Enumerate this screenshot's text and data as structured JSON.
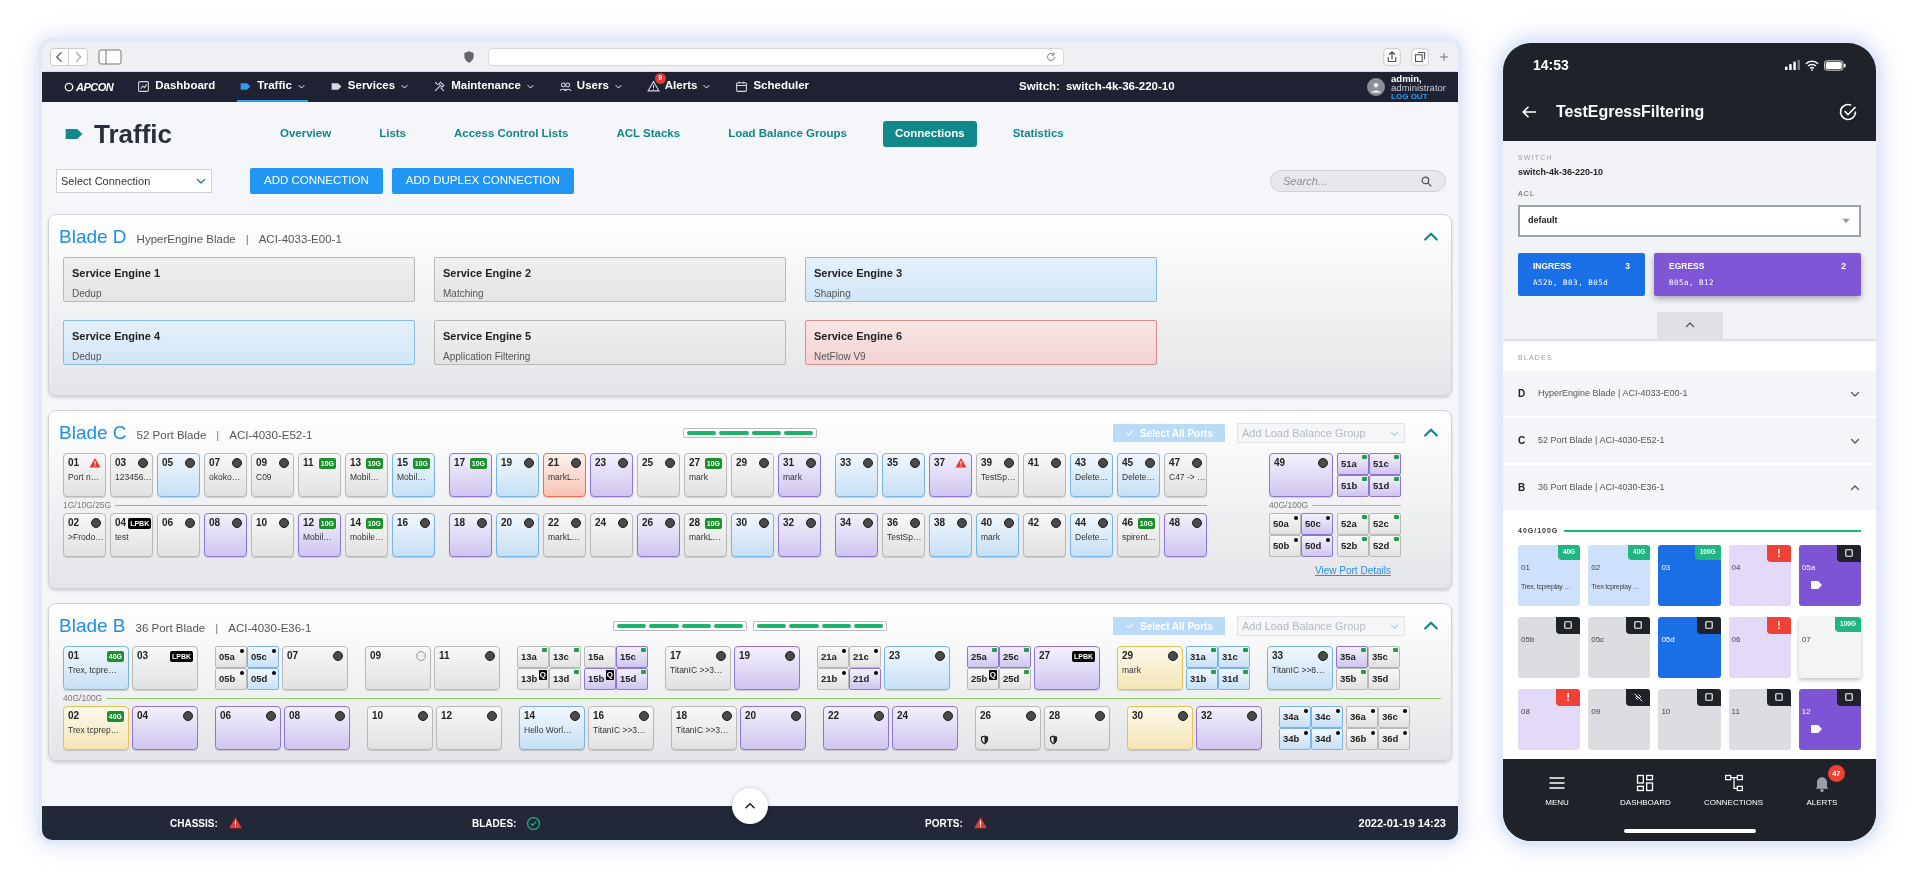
{
  "nav": {
    "logo": "APCON",
    "items": [
      {
        "kind": "dashboard",
        "label": "Dashboard",
        "menu": false,
        "selected": false
      },
      {
        "kind": "traffic",
        "label": "Traffic",
        "menu": true,
        "selected": true
      },
      {
        "kind": "services",
        "label": "Services",
        "menu": true,
        "selected": false
      },
      {
        "kind": "maintenance",
        "label": "Maintenance",
        "menu": true,
        "selected": false
      },
      {
        "kind": "users",
        "label": "Users",
        "menu": true,
        "selected": false
      },
      {
        "kind": "alerts",
        "label": "Alerts",
        "menu": true,
        "selected": false,
        "badge": "9"
      },
      {
        "kind": "scheduler",
        "label": "Scheduler",
        "menu": false,
        "selected": false
      }
    ],
    "switch_label": "Switch:",
    "switch_value": "switch-4k-36-220-10",
    "user_name": "admin,",
    "user_role": "administrator",
    "logout": "LOG OUT"
  },
  "page": {
    "title": "Traffic",
    "tabs": [
      {
        "label": "Overview",
        "selected": false
      },
      {
        "label": "Lists",
        "selected": false
      },
      {
        "label": "Access Control Lists",
        "selected": false
      },
      {
        "label": "ACL Stacks",
        "selected": false
      },
      {
        "label": "Load Balance Groups",
        "selected": false
      },
      {
        "label": "Connections",
        "selected": true
      },
      {
        "label": "Statistics",
        "selected": false
      }
    ],
    "connection_select": "Select Connection",
    "buttons": [
      "ADD CONNECTION",
      "ADD DUPLEX CONNECTION"
    ],
    "search": {
      "placeholder": "Search..."
    }
  },
  "blades": [
    {
      "kind": "engines",
      "title": "Blade D",
      "type": "HyperEngine Blade",
      "separator": "|",
      "model": "ACI-4033-E00-1",
      "expanded": true,
      "engines": [
        {
          "name": "Service Engine 1",
          "detail": "Dedup",
          "color": "#b8b8b8"
        },
        {
          "name": "Service Engine 2",
          "detail": "Matching",
          "color": "#b8b8b8"
        },
        {
          "name": "Service Engine 3",
          "detail": "Shaping",
          "color": "#86bdea"
        },
        {
          "name": "Service Engine 4",
          "detail": "Dedup",
          "color": "#86bdea"
        },
        {
          "name": "Service Engine 5",
          "detail": "Application Filtering",
          "color": "#b8b8b8"
        },
        {
          "name": "Service Engine 6",
          "detail": "NetFlow V9",
          "color": "#e08a8a"
        }
      ]
    },
    {
      "kind": "ports52",
      "title": "Blade C",
      "type": "52 Port Blade",
      "separator": "|",
      "model": "ACI-4030-E52-1",
      "expanded": true,
      "slot_indicators": [
        {
          "kind": "bar"
        }
      ],
      "select_all": {
        "label": "Select All Ports",
        "disabled": true
      },
      "lb_select": {
        "placeholder": "Add Load Balance Group"
      },
      "details_link": "View Port Details",
      "sections": [
        {
          "speed_label": "1G/10G/25G",
          "color": "#7fb0e6",
          "rows": [
            [
              [
                {
                  "kind": "port",
                  "label": "01",
                  "badge": {
                    "kind": "alert"
                  },
                  "name": "Port n…",
                  "color": "#b9b9b9"
                },
                {
                  "kind": "port",
                  "label": "03",
                  "badge": {
                    "kind": "dot"
                  },
                  "name": "123456…",
                  "color": "#b9b9b9"
                },
                {
                  "kind": "port",
                  "label": "05",
                  "badge": {
                    "kind": "dot"
                  },
                  "color": "#79b4e8"
                },
                {
                  "kind": "port",
                  "label": "07",
                  "badge": {
                    "kind": "dot"
                  },
                  "name": "okoko…",
                  "color": "#b9b9b9"
                },
                {
                  "kind": "port",
                  "label": "09",
                  "badge": {
                    "kind": "dot"
                  },
                  "name": "C09",
                  "color": "#b9b9b9"
                },
                {
                  "kind": "port",
                  "label": "11",
                  "badge": {
                    "kind": "speed",
                    "text": "10G"
                  },
                  "color": "#b9b9b9"
                },
                {
                  "kind": "port",
                  "label": "13",
                  "badge": {
                    "kind": "speed",
                    "text": "10G"
                  },
                  "name": "Mobil…",
                  "color": "#b9b9b9"
                },
                {
                  "kind": "port",
                  "label": "15",
                  "badge": {
                    "kind": "speed",
                    "text": "10G"
                  },
                  "name": "Mobil…",
                  "color": "#79b4e8"
                }
              ],
              [
                {
                  "kind": "port",
                  "label": "17",
                  "badge": {
                    "kind": "speed",
                    "text": "10G"
                  },
                  "color": "#8f74da"
                },
                {
                  "kind": "port",
                  "label": "19",
                  "badge": {
                    "kind": "dot"
                  },
                  "color": "#79b4e8"
                },
                {
                  "kind": "port",
                  "label": "21",
                  "badge": {
                    "kind": "dot"
                  },
                  "name": "markL…",
                  "color": "#e8714c"
                },
                {
                  "kind": "port",
                  "label": "23",
                  "badge": {
                    "kind": "dot"
                  },
                  "color": "#8f74da"
                },
                {
                  "kind": "port",
                  "label": "25",
                  "badge": {
                    "kind": "dot"
                  },
                  "color": "#b9b9b9"
                },
                {
                  "kind": "port",
                  "label": "27",
                  "badge": {
                    "kind": "speed",
                    "text": "10G"
                  },
                  "name": "mark",
                  "color": "#b9b9b9"
                },
                {
                  "kind": "port",
                  "label": "29",
                  "badge": {
                    "kind": "dot"
                  },
                  "color": "#b9b9b9"
                },
                {
                  "kind": "port",
                  "label": "31",
                  "badge": {
                    "kind": "dot"
                  },
                  "name": "mark",
                  "color": "#8f74da"
                }
              ],
              [
                {
                  "kind": "port",
                  "label": "33",
                  "badge": {
                    "kind": "dot"
                  },
                  "color": "#79b4e8"
                },
                {
                  "kind": "port",
                  "label": "35",
                  "badge": {
                    "kind": "dot"
                  },
                  "color": "#79b4e8"
                },
                {
                  "kind": "port",
                  "label": "37",
                  "badge": {
                    "kind": "alert"
                  },
                  "color": "#8f74da"
                },
                {
                  "kind": "port",
                  "label": "39",
                  "badge": {
                    "kind": "dot"
                  },
                  "name": "TestSp…",
                  "color": "#b9b9b9"
                },
                {
                  "kind": "port",
                  "label": "41",
                  "badge": {
                    "kind": "dot"
                  },
                  "color": "#b9b9b9"
                },
                {
                  "kind": "port",
                  "label": "43",
                  "badge": {
                    "kind": "dot"
                  },
                  "name": "Delete…",
                  "color": "#79b4e8"
                },
                {
                  "kind": "port",
                  "label": "45",
                  "badge": {
                    "kind": "dot"
                  },
                  "name": "Delete…",
                  "color": "#79b4e8"
                },
                {
                  "kind": "port",
                  "label": "47",
                  "badge": {
                    "kind": "dot"
                  },
                  "name": "C47 -> …",
                  "color": "#b9b9b9"
                }
              ]
            ],
            [
              [
                {
                  "kind": "port",
                  "label": "02",
                  "badge": {
                    "kind": "dot"
                  },
                  "name": ">Frodo…",
                  "color": "#b9b9b9"
                },
                {
                  "kind": "port",
                  "label": "04",
                  "badge": {
                    "kind": "loopback",
                    "text": "LPBK"
                  },
                  "name": "test",
                  "color": "#b9b9b9"
                },
                {
                  "kind": "port",
                  "label": "06",
                  "badge": {
                    "kind": "dot"
                  },
                  "color": "#b9b9b9"
                },
                {
                  "kind": "port",
                  "label": "08",
                  "badge": {
                    "kind": "dot"
                  },
                  "color": "#8f74da"
                },
                {
                  "kind": "port",
                  "label": "10",
                  "badge": {
                    "kind": "dot"
                  },
                  "color": "#b9b9b9"
                },
                {
                  "kind": "port",
                  "label": "12",
                  "badge": {
                    "kind": "speed",
                    "text": "10G"
                  },
                  "name": "Mobil…",
                  "color": "#8f74da"
                },
                {
                  "kind": "port",
                  "label": "14",
                  "badge": {
                    "kind": "speed",
                    "text": "10G"
                  },
                  "name": "mobile…",
                  "color": "#b9b9b9"
                },
                {
                  "kind": "port",
                  "label": "16",
                  "badge": {
                    "kind": "dot"
                  },
                  "color": "#79b4e8"
                }
              ],
              [
                {
                  "kind": "port",
                  "label": "18",
                  "badge": {
                    "kind": "dot"
                  },
                  "color": "#8f74da"
                },
                {
                  "kind": "port",
                  "label": "20",
                  "badge": {
                    "kind": "dot"
                  },
                  "color": "#79b4e8"
                },
                {
                  "kind": "port",
                  "label": "22",
                  "badge": {
                    "kind": "dot"
                  },
                  "name": "markL…",
                  "color": "#b9b9b9"
                },
                {
                  "kind": "port",
                  "label": "24",
                  "badge": {
                    "kind": "dot"
                  },
                  "color": "#b9b9b9"
                },
                {
                  "kind": "port",
                  "label": "26",
                  "badge": {
                    "kind": "dot"
                  },
                  "color": "#8f74da"
                },
                {
                  "kind": "port",
                  "label": "28",
                  "badge": {
                    "kind": "speed",
                    "text": "10G"
                  },
                  "name": "markL…",
                  "color": "#b9b9b9"
                },
                {
                  "kind": "port",
                  "label": "30",
                  "badge": {
                    "kind": "dot"
                  },
                  "color": "#79b4e8"
                },
                {
                  "kind": "port",
                  "label": "32",
                  "badge": {
                    "kind": "dot"
                  },
                  "color": "#8f74da"
                }
              ],
              [
                {
                  "kind": "port",
                  "label": "34",
                  "badge": {
                    "kind": "dot"
                  },
                  "color": "#8f74da"
                },
                {
                  "kind": "port",
                  "label": "36",
                  "badge": {
                    "kind": "dot"
                  },
                  "name": "TestSp…",
                  "color": "#b9b9b9"
                },
                {
                  "kind": "port",
                  "label": "38",
                  "badge": {
                    "kind": "dot"
                  },
                  "color": "#79b4e8"
                },
                {
                  "kind": "port",
                  "label": "40",
                  "badge": {
                    "kind": "dot"
                  },
                  "name": "mark",
                  "color": "#79b4e8"
                },
                {
                  "kind": "port",
                  "label": "42",
                  "badge": {
                    "kind": "dot"
                  },
                  "color": "#b9b9b9"
                },
                {
                  "kind": "port",
                  "label": "44",
                  "badge": {
                    "kind": "dot"
                  },
                  "name": "Delete…",
                  "color": "#79b4e8"
                },
                {
                  "kind": "port",
                  "label": "46",
                  "badge": {
                    "kind": "speed",
                    "text": "10G"
                  },
                  "name": "spirent…",
                  "color": "#b9b9b9"
                },
                {
                  "kind": "port",
                  "label": "48",
                  "badge": {
                    "kind": "dot"
                  },
                  "color": "#8f74da"
                }
              ]
            ]
          ]
        },
        {
          "speed_label": "40G/100G",
          "color": "#8ccf6a",
          "rows": [
            [
              [
                {
                  "kind": "wide-port",
                  "label": "49",
                  "badge": {
                    "kind": "dot"
                  },
                  "color": "#8f74da"
                },
                {
                  "kind": "quad",
                  "cells": [
                    {
                      "label": "51a",
                      "color": "#8f74da",
                      "marker": {
                        "kind": "link"
                      }
                    },
                    {
                      "label": "51c",
                      "color": "#8f74da",
                      "marker": {
                        "kind": "link"
                      }
                    },
                    {
                      "label": "51b",
                      "color": "#8f74da",
                      "marker": {
                        "kind": "link"
                      }
                    },
                    {
                      "label": "51d",
                      "color": "#8f74da",
                      "marker": {
                        "kind": "link"
                      }
                    }
                  ]
                }
              ]
            ],
            [
              [
                {
                  "kind": "quad",
                  "cells": [
                    {
                      "label": "50a",
                      "color": "#b9b9b9",
                      "marker": {
                        "kind": "dot"
                      }
                    },
                    {
                      "label": "50c",
                      "color": "#8f74da",
                      "marker": {
                        "kind": "dot"
                      }
                    },
                    {
                      "label": "50b",
                      "color": "#b9b9b9",
                      "marker": {
                        "kind": "dot"
                      }
                    },
                    {
                      "label": "50d",
                      "color": "#8f74da",
                      "marker": {
                        "kind": "dot"
                      }
                    }
                  ]
                },
                {
                  "kind": "quad",
                  "cells": [
                    {
                      "label": "52a",
                      "color": "#b9b9b9",
                      "marker": {
                        "kind": "link"
                      }
                    },
                    {
                      "label": "52c",
                      "color": "#b9b9b9",
                      "marker": {
                        "kind": "link"
                      }
                    },
                    {
                      "label": "52b",
                      "color": "#b9b9b9",
                      "marker": {
                        "kind": "link"
                      }
                    },
                    {
                      "label": "52d",
                      "color": "#b9b9b9",
                      "marker": {
                        "kind": "link"
                      }
                    }
                  ]
                }
              ]
            ]
          ]
        }
      ]
    },
    {
      "kind": "ports36",
      "title": "Blade B",
      "type": "36 Port Blade",
      "separator": "|",
      "model": "ACI-4030-E36-1",
      "expanded": true,
      "slot_indicators": [
        {
          "kind": "bar"
        },
        {
          "kind": "bar"
        }
      ],
      "select_all": {
        "label": "Select All Ports",
        "disabled": true
      },
      "lb_select": {
        "placeholder": "Add Load Balance Group"
      },
      "sections": [
        {
          "speed_label": "40G/100G",
          "color": "#8ccf6a",
          "rows": [
            [
              [
                {
                  "kind": "port",
                  "label": "01",
                  "badge": {
                    "kind": "speed",
                    "text": "40G"
                  },
                  "name": "Trex, tcpre…",
                  "color": "#79b4e8"
                },
                {
                  "kind": "port",
                  "label": "03",
                  "badge": {
                    "kind": "loopback",
                    "text": "LPBK"
                  },
                  "color": "#b9b9b9"
                }
              ],
              [
                {
                  "kind": "quad",
                  "cells": [
                    {
                      "label": "05a",
                      "color": "#b9b9b9",
                      "marker": {
                        "kind": "dot"
                      }
                    },
                    {
                      "label": "05c",
                      "color": "#79b4e8",
                      "marker": {
                        "kind": "dot"
                      }
                    },
                    {
                      "label": "05b",
                      "color": "#b9b9b9",
                      "marker": {
                        "kind": "dot"
                      }
                    },
                    {
                      "label": "05d",
                      "color": "#79b4e8",
                      "marker": {
                        "kind": "dot"
                      }
                    }
                  ]
                },
                {
                  "kind": "port",
                  "label": "07",
                  "badge": {
                    "kind": "dot"
                  },
                  "color": "#b9b9b9"
                }
              ],
              [
                {
                  "kind": "port",
                  "label": "09",
                  "badge": {
                    "kind": "ring"
                  },
                  "color": "#b9b9b9"
                },
                {
                  "kind": "port",
                  "label": "11",
                  "badge": {
                    "kind": "dot"
                  },
                  "color": "#b9b9b9"
                }
              ],
              [
                {
                  "kind": "quad",
                  "cells": [
                    {
                      "label": "13a",
                      "color": "#b9b9b9",
                      "marker": {
                        "kind": "link"
                      }
                    },
                    {
                      "label": "13c",
                      "color": "#b9b9b9",
                      "marker": {
                        "kind": "link"
                      }
                    },
                    {
                      "label": "13b",
                      "color": "#b9b9b9",
                      "tag": "Q"
                    },
                    {
                      "label": "13d",
                      "color": "#b9b9b9",
                      "marker": {
                        "kind": "link"
                      }
                    }
                  ]
                },
                {
                  "kind": "quad",
                  "cells": [
                    {
                      "label": "15a",
                      "color": "#b9b9b9"
                    },
                    {
                      "label": "15c",
                      "color": "#8f74da",
                      "marker": {
                        "kind": "link"
                      }
                    },
                    {
                      "label": "15b",
                      "color": "#8f74da",
                      "tag": "Q"
                    },
                    {
                      "label": "15d",
                      "color": "#8f74da",
                      "marker": {
                        "kind": "link"
                      }
                    }
                  ]
                }
              ],
              [
                {
                  "kind": "port",
                  "label": "17",
                  "badge": {
                    "kind": "dot"
                  },
                  "name": "TitanIC >>3…",
                  "color": "#b9b9b9"
                },
                {
                  "kind": "port",
                  "label": "19",
                  "badge": {
                    "kind": "dot"
                  },
                  "color": "#8f74da"
                }
              ],
              [
                {
                  "kind": "quad",
                  "cells": [
                    {
                      "label": "21a",
                      "color": "#b9b9b9",
                      "marker": {
                        "kind": "dot"
                      }
                    },
                    {
                      "label": "21c",
                      "color": "#b9b9b9",
                      "marker": {
                        "kind": "dot"
                      }
                    },
                    {
                      "label": "21b",
                      "color": "#b9b9b9",
                      "marker": {
                        "kind": "dot"
                      }
                    },
                    {
                      "label": "21d",
                      "color": "#8f74da",
                      "marker": {
                        "kind": "dot"
                      }
                    }
                  ]
                },
                {
                  "kind": "port",
                  "label": "23",
                  "badge": {
                    "kind": "dot"
                  },
                  "color": "#79b4e8"
                }
              ],
              [
                {
                  "kind": "quad",
                  "cells": [
                    {
                      "label": "25a",
                      "color": "#8f74da",
                      "marker": {
                        "kind": "link"
                      }
                    },
                    {
                      "label": "25c",
                      "color": "#8f74da",
                      "marker": {
                        "kind": "link"
                      }
                    },
                    {
                      "label": "25b",
                      "color": "#b9b9b9",
                      "tag": "Q"
                    },
                    {
                      "label": "25d",
                      "color": "#b9b9b9",
                      "marker": {
                        "kind": "link"
                      }
                    }
                  ]
                },
                {
                  "kind": "port",
                  "label": "27",
                  "badge": {
                    "kind": "loopback",
                    "text": "LPBK"
                  },
                  "color": "#8f74da"
                }
              ],
              [
                {
                  "kind": "port",
                  "label": "29",
                  "badge": {
                    "kind": "dot"
                  },
                  "name": "mark",
                  "color": "#e6c24f"
                },
                {
                  "kind": "quad",
                  "cells": [
                    {
                      "label": "31a",
                      "color": "#79b4e8",
                      "marker": {
                        "kind": "link"
                      }
                    },
                    {
                      "label": "31c",
                      "color": "#79b4e8",
                      "marker": {
                        "kind": "link"
                      }
                    },
                    {
                      "label": "31b",
                      "color": "#79b4e8",
                      "marker": {
                        "kind": "link"
                      }
                    },
                    {
                      "label": "31d",
                      "color": "#79b4e8",
                      "marker": {
                        "kind": "link"
                      }
                    }
                  ]
                }
              ],
              [
                {
                  "kind": "port",
                  "label": "33",
                  "badge": {
                    "kind": "dot"
                  },
                  "name": "TitanIC >>8…",
                  "color": "#79b4e8"
                },
                {
                  "kind": "quad",
                  "cells": [
                    {
                      "label": "35a",
                      "color": "#8f74da",
                      "marker": {
                        "kind": "link"
                      }
                    },
                    {
                      "label": "35c",
                      "color": "#b9b9b9",
                      "marker": {
                        "kind": "link"
                      }
                    },
                    {
                      "label": "35b",
                      "color": "#b9b9b9",
                      "marker": {
                        "kind": "link"
                      }
                    },
                    {
                      "label": "35d",
                      "color": "#b9b9b9"
                    }
                  ]
                }
              ]
            ],
            [
              [
                {
                  "kind": "port",
                  "label": "02",
                  "badge": {
                    "kind": "speed",
                    "text": "40G"
                  },
                  "name": "Trex tcprep…",
                  "color": "#e6c24f"
                },
                {
                  "kind": "port",
                  "label": "04",
                  "badge": {
                    "kind": "dot"
                  },
                  "color": "#8f74da"
                }
              ],
              [
                {
                  "kind": "port",
                  "label": "06",
                  "badge": {
                    "kind": "dot"
                  },
                  "color": "#8f74da"
                },
                {
                  "kind": "port",
                  "label": "08",
                  "badge": {
                    "kind": "dot"
                  },
                  "color": "#8f74da"
                }
              ],
              [
                {
                  "kind": "port",
                  "label": "10",
                  "badge": {
                    "kind": "dot"
                  },
                  "color": "#b9b9b9"
                },
                {
                  "kind": "port",
                  "label": "12",
                  "badge": {
                    "kind": "dot"
                  },
                  "color": "#b9b9b9"
                }
              ],
              [
                {
                  "kind": "port",
                  "label": "14",
                  "badge": {
                    "kind": "dot"
                  },
                  "name": "Hello Worl…",
                  "color": "#79b4e8"
                },
                {
                  "kind": "port",
                  "label": "16",
                  "badge": {
                    "kind": "dot"
                  },
                  "name": "TitanIC >>3…",
                  "color": "#b9b9b9"
                }
              ],
              [
                {
                  "kind": "port",
                  "label": "18",
                  "badge": {
                    "kind": "dot"
                  },
                  "name": "TitanIC >>3…",
                  "color": "#b9b9b9"
                },
                {
                  "kind": "port",
                  "label": "20",
                  "badge": {
                    "kind": "dot"
                  },
                  "color": "#8f74da"
                }
              ],
              [
                {
                  "kind": "port",
                  "label": "22",
                  "badge": {
                    "kind": "dot"
                  },
                  "color": "#8f74da"
                },
                {
                  "kind": "port",
                  "label": "24",
                  "badge": {
                    "kind": "dot"
                  },
                  "color": "#8f74da"
                }
              ],
              [
                {
                  "kind": "port",
                  "label": "26",
                  "badge": {
                    "kind": "dot"
                  },
                  "shield": true,
                  "color": "#b9b9b9"
                },
                {
                  "kind": "port",
                  "label": "28",
                  "badge": {
                    "kind": "dot"
                  },
                  "shield": true,
                  "color": "#b9b9b9"
                }
              ],
              [
                {
                  "kind": "port",
                  "label": "30",
                  "badge": {
                    "kind": "dot"
                  },
                  "color": "#e6c24f"
                },
                {
                  "kind": "port",
                  "label": "32",
                  "badge": {
                    "kind": "dot"
                  },
                  "color": "#8f74da"
                }
              ],
              [
                {
                  "kind": "quad",
                  "cells": [
                    {
                      "label": "34a",
                      "color": "#79b4e8",
                      "marker": {
                        "kind": "dot"
                      }
                    },
                    {
                      "label": "34c",
                      "color": "#79b4e8",
                      "marker": {
                        "kind": "dot"
                      }
                    },
                    {
                      "label": "34b",
                      "color": "#79b4e8",
                      "marker": {
                        "kind": "dot"
                      }
                    },
                    {
                      "label": "34d",
                      "color": "#79b4e8",
                      "marker": {
                        "kind": "dot"
                      }
                    }
                  ]
                },
                {
                  "kind": "quad",
                  "cells": [
                    {
                      "label": "36a",
                      "color": "#b9b9b9",
                      "marker": {
                        "kind": "dot"
                      }
                    },
                    {
                      "label": "36c",
                      "color": "#b9b9b9",
                      "marker": {
                        "kind": "dot"
                      }
                    },
                    {
                      "label": "36b",
                      "color": "#b9b9b9",
                      "marker": {
                        "kind": "dot"
                      }
                    },
                    {
                      "label": "36d",
                      "color": "#b9b9b9",
                      "marker": {
                        "kind": "dot"
                      }
                    }
                  ]
                }
              ]
            ]
          ]
        }
      ]
    }
  ],
  "status_bar": {
    "items": [
      {
        "label": "CHASSIS:",
        "kind": "alert"
      },
      {
        "label": "BLADES:",
        "kind": "ok"
      },
      {
        "label": "PORTS:",
        "kind": "alert"
      }
    ],
    "datetime": "2022-01-19 14:23"
  },
  "mobile": {
    "time": "14:53",
    "title": "TestEgressFiltering",
    "switch_label": "SWITCH",
    "switch_value": "switch-4k-36-220-10",
    "acl_label": "ACL",
    "acl_value": "default",
    "directions": [
      {
        "label": "INGRESS",
        "count": "3",
        "ports": "A52b, B03, B05d",
        "color": "#1b6fe6",
        "selected": false
      },
      {
        "label": "EGRESS",
        "count": "2",
        "ports": "B05a, B12",
        "color": "#7f57d6",
        "selected": true
      }
    ],
    "blades_label": "BLADES",
    "blades": [
      {
        "letter": "D",
        "text": "HyperEngine Blade | ACI-4033-E00-1",
        "expanded": false
      },
      {
        "letter": "C",
        "text": "52 Port Blade | ACI-4030-E52-1",
        "expanded": false
      },
      {
        "letter": "B",
        "text": "36 Port Blade | ACI-4030-E36-1",
        "expanded": true
      }
    ],
    "speed_label": "40G/100G",
    "ports": [
      {
        "label": "01",
        "color": "#cde2fa",
        "badge": {
          "kind": "speed",
          "text": "40G"
        },
        "name": "Trex, tcpreplay …",
        "tag": false
      },
      {
        "label": "02",
        "color": "#cde2fa",
        "badge": {
          "kind": "speed",
          "text": "40G"
        },
        "name": "Trex tcpreplay …",
        "tag": false
      },
      {
        "label": "03",
        "color": "#1b6fe6",
        "badge": {
          "kind": "speed",
          "text": "100G"
        },
        "tag": false
      },
      {
        "label": "04",
        "color": "#e3dafa",
        "badge": {
          "kind": "alert",
          "text": "!"
        },
        "tag": false
      },
      {
        "label": "05a",
        "color": "#7c55d4",
        "badge": {
          "kind": "free"
        },
        "tag": true
      },
      {
        "label": "05b",
        "color": "#dcdde1",
        "badge": {
          "kind": "free"
        },
        "tag": false
      },
      {
        "label": "05c",
        "color": "#dcdde1",
        "badge": {
          "kind": "free"
        },
        "tag": false
      },
      {
        "label": "05d",
        "color": "#1b6fe6",
        "badge": {
          "kind": "free"
        },
        "tag": false
      },
      {
        "label": "06",
        "color": "#e3dafa",
        "badge": {
          "kind": "alert",
          "text": "!"
        },
        "tag": false
      },
      {
        "label": "07",
        "color": "#f3f4f6",
        "badge": {
          "kind": "speed",
          "text": "100G"
        },
        "tag": false
      },
      {
        "label": "08",
        "color": "#e3dafa",
        "badge": {
          "kind": "alert",
          "text": "!"
        },
        "tag": false
      },
      {
        "label": "09",
        "color": "#dcdde1",
        "badge": {
          "kind": "nolink"
        },
        "tag": false
      },
      {
        "label": "10",
        "color": "#dcdde1",
        "badge": {
          "kind": "free"
        },
        "tag": false
      },
      {
        "label": "11",
        "color": "#dcdde1",
        "badge": {
          "kind": "free"
        },
        "tag": false
      },
      {
        "label": "12",
        "color": "#7c55d4",
        "badge": {
          "kind": "free"
        },
        "tag": true
      }
    ],
    "nav": [
      {
        "kind": "menu",
        "label": "MENU"
      },
      {
        "kind": "dashboard",
        "label": "DASHBOARD"
      },
      {
        "kind": "connections",
        "label": "CONNECTIONS"
      },
      {
        "kind": "alerts",
        "label": "ALERTS",
        "badge": "47"
      }
    ]
  }
}
